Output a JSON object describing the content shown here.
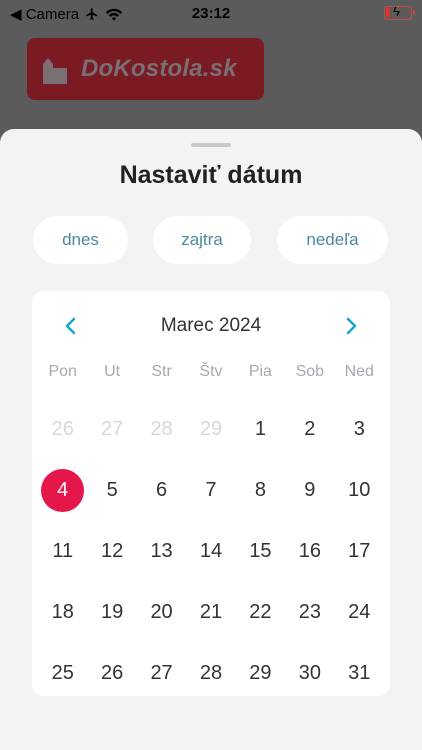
{
  "status_bar": {
    "back_label": "◀ Camera",
    "time": "23:12"
  },
  "logo": {
    "text": "DoKostola.sk"
  },
  "sheet": {
    "title": "Nastaviť dátum",
    "quick_picks": [
      {
        "label": "dnes"
      },
      {
        "label": "zajtra"
      },
      {
        "label": "nedeľa"
      }
    ],
    "calendar": {
      "month_label": "Marec 2024",
      "weekdays": [
        "Pon",
        "Ut",
        "Str",
        "Štv",
        "Pia",
        "Sob",
        "Ned"
      ],
      "days": [
        {
          "d": "26",
          "outside": true
        },
        {
          "d": "27",
          "outside": true
        },
        {
          "d": "28",
          "outside": true
        },
        {
          "d": "29",
          "outside": true
        },
        {
          "d": "1"
        },
        {
          "d": "2"
        },
        {
          "d": "3"
        },
        {
          "d": "4",
          "selected": true
        },
        {
          "d": "5"
        },
        {
          "d": "6"
        },
        {
          "d": "7"
        },
        {
          "d": "8"
        },
        {
          "d": "9"
        },
        {
          "d": "10"
        },
        {
          "d": "11"
        },
        {
          "d": "12"
        },
        {
          "d": "13"
        },
        {
          "d": "14"
        },
        {
          "d": "15"
        },
        {
          "d": "16"
        },
        {
          "d": "17"
        },
        {
          "d": "18"
        },
        {
          "d": "19"
        },
        {
          "d": "20"
        },
        {
          "d": "21"
        },
        {
          "d": "22"
        },
        {
          "d": "23"
        },
        {
          "d": "24"
        },
        {
          "d": "25"
        },
        {
          "d": "26"
        },
        {
          "d": "27"
        },
        {
          "d": "28"
        },
        {
          "d": "29"
        },
        {
          "d": "30"
        },
        {
          "d": "31"
        }
      ]
    }
  },
  "colors": {
    "accent": "#e5174a",
    "nav_arrow": "#1aa7cc",
    "chip_text": "#4a8a9c"
  }
}
